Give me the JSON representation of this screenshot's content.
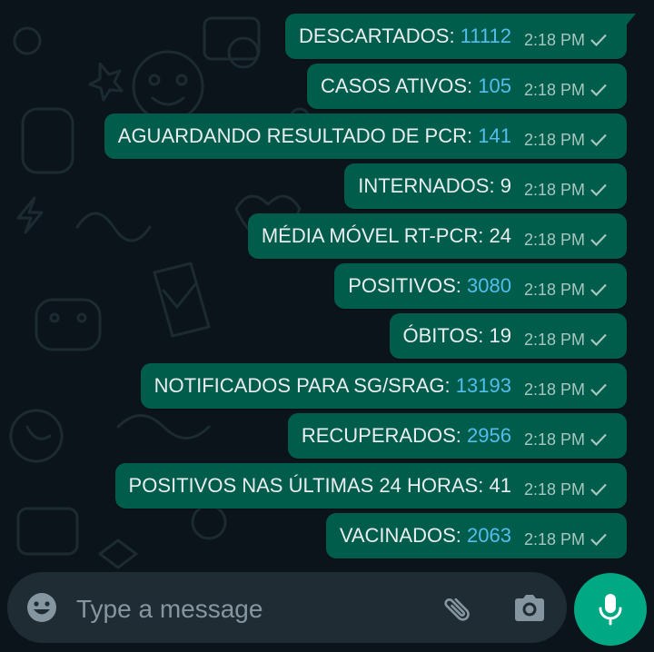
{
  "messages": [
    {
      "label": "DESCARTADOS: ",
      "value": "11112",
      "highlight": true,
      "time": "2:18 PM"
    },
    {
      "label": "CASOS ATIVOS: ",
      "value": "105",
      "highlight": true,
      "time": "2:18 PM"
    },
    {
      "label": "AGUARDANDO RESULTADO DE PCR: ",
      "value": "141",
      "highlight": true,
      "time": "2:18 PM"
    },
    {
      "label": "INTERNADOS: ",
      "value": "9",
      "highlight": false,
      "time": "2:18 PM"
    },
    {
      "label": "MÉDIA MÓVEL RT-PCR: ",
      "value": "24",
      "highlight": false,
      "time": "2:18 PM"
    },
    {
      "label": "POSITIVOS: ",
      "value": "3080",
      "highlight": true,
      "time": "2:18 PM"
    },
    {
      "label": "ÓBITOS: ",
      "value": "19",
      "highlight": false,
      "time": "2:18 PM"
    },
    {
      "label": "NOTIFICADOS PARA SG/SRAG: ",
      "value": "13193",
      "highlight": true,
      "time": "2:18 PM"
    },
    {
      "label": "RECUPERADOS: ",
      "value": "2956",
      "highlight": true,
      "time": "2:18 PM"
    },
    {
      "label": "POSITIVOS NAS ÚLTIMAS 24 HORAS: ",
      "value": "41",
      "highlight": false,
      "time": "2:18 PM"
    },
    {
      "label": "VACINADOS: ",
      "value": "2063",
      "highlight": true,
      "time": "2:18 PM"
    }
  ],
  "composer": {
    "placeholder": "Type a message",
    "emoji_icon": "smiley-icon",
    "attach_icon": "paperclip-icon",
    "camera_icon": "camera-icon",
    "send_icon": "microphone-icon"
  },
  "colors": {
    "background": "#0b141a",
    "bubble": "#005c4b",
    "number_accent": "#53bdeb",
    "mic_button": "#00a884"
  }
}
